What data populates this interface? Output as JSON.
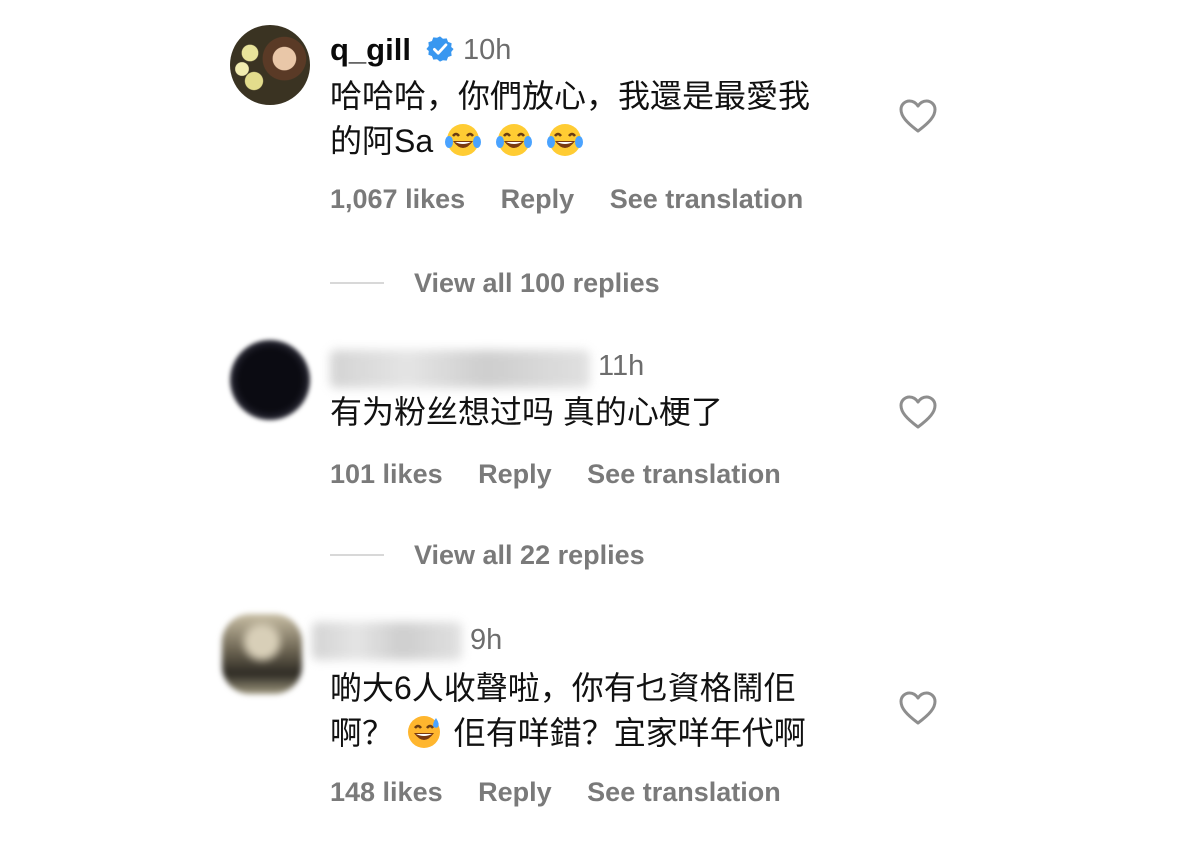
{
  "comments": [
    {
      "username": "q_gill",
      "verified": true,
      "time": "10h",
      "text_lines": [
        "哈哈哈，你們放心，我還是最愛我",
        "的阿Sa"
      ],
      "emoji": [
        "tears-of-joy",
        "tears-of-joy",
        "tears-of-joy"
      ],
      "likes": "1,067 likes",
      "reply": "Reply",
      "translate": "See translation",
      "view_replies": "View all 100 replies"
    },
    {
      "username": "",
      "time": "11h",
      "text_lines": [
        "有为粉丝想过吗 真的心梗了"
      ],
      "likes": "101 likes",
      "reply": "Reply",
      "translate": "See translation",
      "view_replies": "View all 22 replies"
    },
    {
      "username": "",
      "time": "9h",
      "text_lines": [
        "啲大6人收聲啦，你有乜資格鬧佢",
        "啊？",
        "佢有咩錯？宜家咩年代啊"
      ],
      "emoji": [
        "grinning-sweat"
      ],
      "likes": "148 likes",
      "reply": "Reply",
      "translate": "See translation"
    }
  ],
  "colors": {
    "verified_blue": "#3897f0",
    "meta_gray": "#7a7a7a",
    "text": "#111111"
  },
  "icons": [
    "verified-badge-icon",
    "heart-icon",
    "tears-of-joy-emoji",
    "grinning-sweat-emoji"
  ]
}
